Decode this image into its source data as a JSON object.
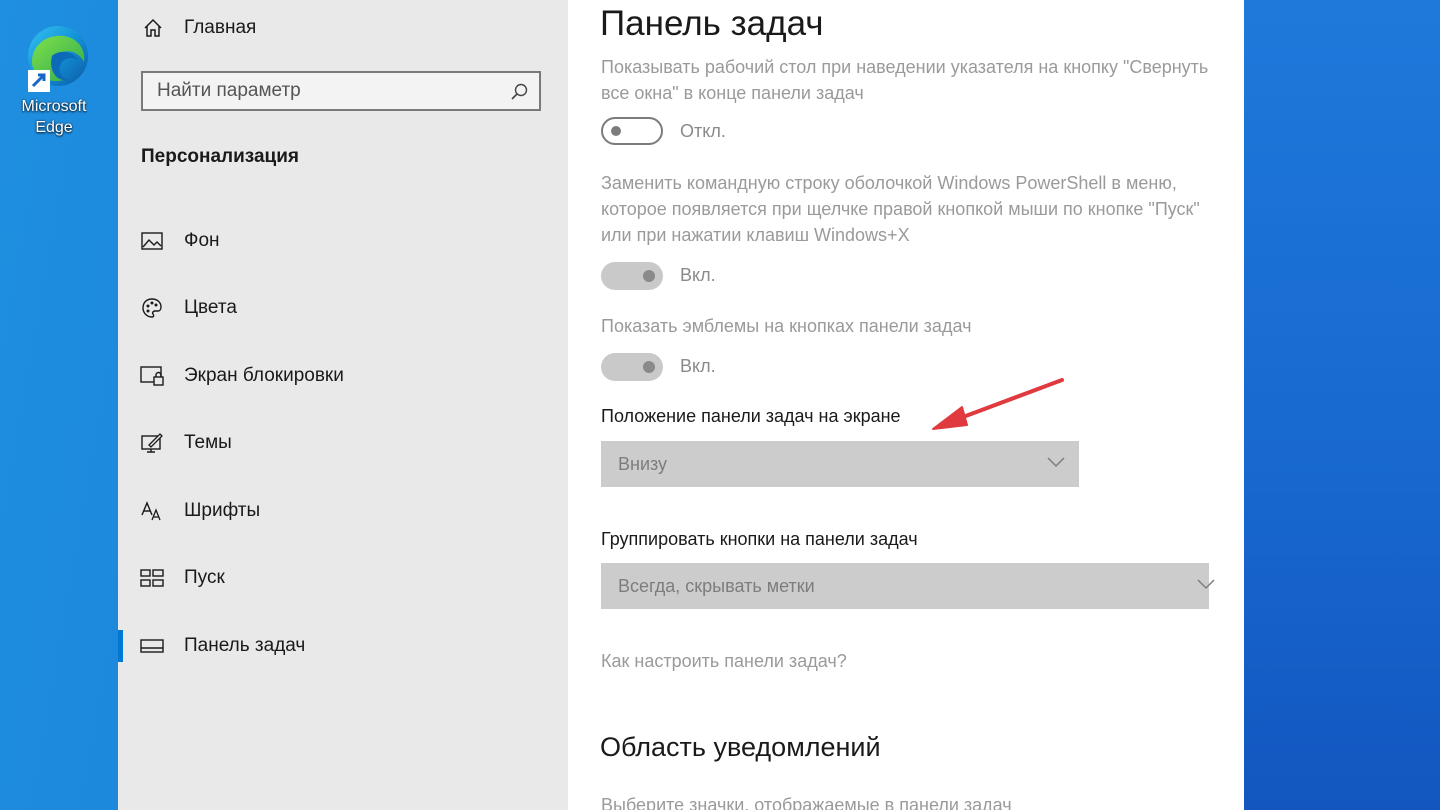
{
  "desktop": {
    "edge_label_line1": "Microsoft",
    "edge_label_line2": "Edge"
  },
  "sidebar": {
    "home_label": "Главная",
    "search_placeholder": "Найти параметр",
    "section_title": "Персонализация",
    "items": [
      {
        "label": "Фон",
        "icon": "picture-icon"
      },
      {
        "label": "Цвета",
        "icon": "palette-icon"
      },
      {
        "label": "Экран блокировки",
        "icon": "lock-screen-icon"
      },
      {
        "label": "Темы",
        "icon": "themes-icon"
      },
      {
        "label": "Шрифты",
        "icon": "fonts-icon"
      },
      {
        "label": "Пуск",
        "icon": "start-icon"
      },
      {
        "label": "Панель задач",
        "icon": "taskbar-icon",
        "active": true
      }
    ]
  },
  "content": {
    "title": "Панель задач",
    "show_desktop_text": "Показывать рабочий стол при наведении указателя на кнопку \"Свернуть все окна\" в конце панели задач",
    "show_desktop_toggle": "Откл.",
    "powershell_text": "Заменить командную строку оболочкой Windows PowerShell в меню, которое появляется при щелчке правой кнопкой мыши по кнопке \"Пуск\" или при нажатии клавиш Windows+X",
    "powershell_toggle": "Вкл.",
    "badges_text": "Показать эмблемы на кнопках панели задач",
    "badges_toggle": "Вкл.",
    "position_label": "Положение панели задач на экране",
    "position_value": "Внизу",
    "group_label": "Группировать кнопки на панели задач",
    "group_value": "Всегда, скрывать метки",
    "help_link": "Как настроить панели задач?",
    "notifications_heading": "Область уведомлений",
    "notifications_text": "Выберите значки, отображаемые в панели задач"
  },
  "colors": {
    "accent": "#0078d4",
    "annotation_arrow": "#e0393e"
  }
}
